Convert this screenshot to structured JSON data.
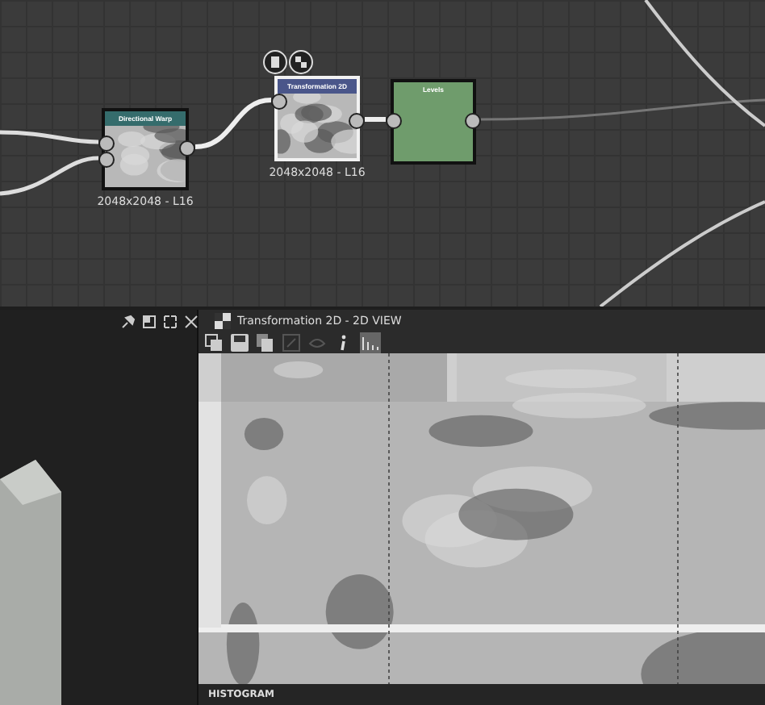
{
  "graph": {
    "nodes": [
      {
        "title": "Directional Warp",
        "kind": "texture",
        "color": "#356c6c",
        "resolution": "2048x2048 - L16",
        "selected": false
      },
      {
        "title": "Transformation 2D",
        "kind": "texture",
        "color": "#4a568a",
        "resolution": "2048x2048 - L16",
        "selected": true
      },
      {
        "title": "Levels",
        "kind": "color",
        "color": "#6f9c6c",
        "selected": false
      }
    ]
  },
  "panel": {
    "title": "Transformation 2D - 2D VIEW",
    "footer": "HISTOGRAM"
  }
}
